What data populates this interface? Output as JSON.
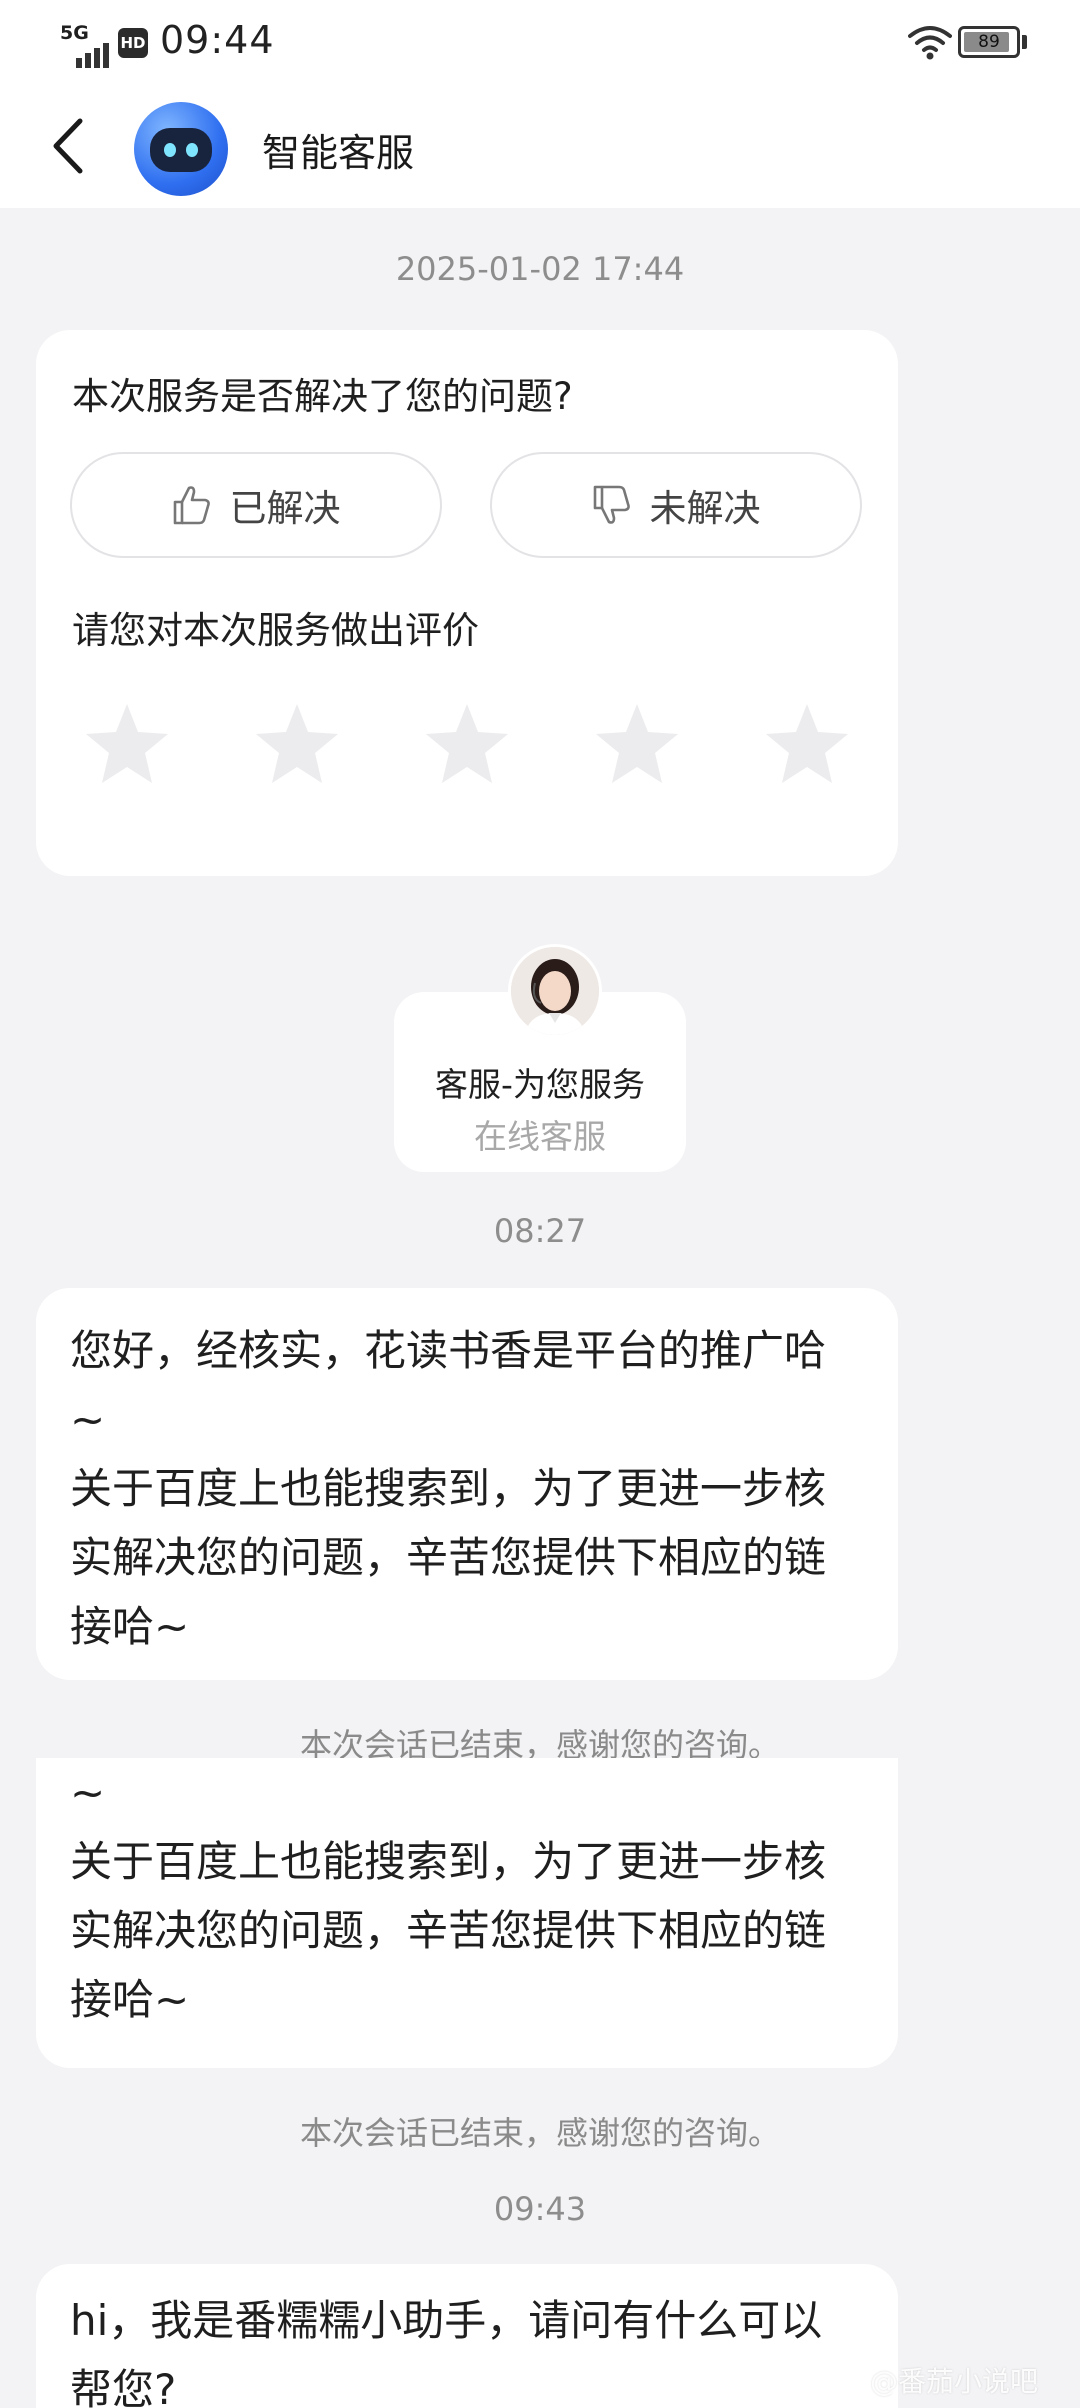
{
  "status_bar": {
    "network": "5G",
    "hd": "HD",
    "time": "09:44",
    "battery_level": 89,
    "battery_text": "89"
  },
  "header": {
    "title": "智能客服",
    "back_icon": "chevron-left-icon",
    "avatar_icon": "robot-icon"
  },
  "chat": {
    "timestamp_1": "2025-01-02 17:44",
    "survey": {
      "question": "本次服务是否解决了您的问题?",
      "resolved_label": "已解决",
      "unresolved_label": "未解决",
      "rate_prompt": "请您对本次服务做出评价",
      "stars_filled": 0,
      "stars_total": 5
    },
    "agent": {
      "name": "客服-为您服务",
      "role": "在线客服"
    },
    "timestamp_2": "08:27",
    "message_1": "您好，经核实，花读书香是平台的推广哈\n~\n关于百度上也能搜索到，为了更进一步核\n实解决您的问题，辛苦您提供下相应的链\n接哈~",
    "system_note_1": "本次会话已结束，感谢您的咨询。",
    "message_2": "~\n关于百度上也能搜索到，为了更进一步核\n实解决您的问题，辛苦您提供下相应的链\n接哈~",
    "system_note_2": "本次会话已结束，感谢您的咨询。",
    "timestamp_3": "09:43",
    "message_3": "hi，我是番糯糯小助手，请问有什么可以\n帮您?"
  },
  "watermark": "@番茄小说吧",
  "colors": {
    "background": "#f3f3f5",
    "card": "#ffffff",
    "muted_text": "#8d8d8d",
    "star_empty": "#ececee"
  }
}
